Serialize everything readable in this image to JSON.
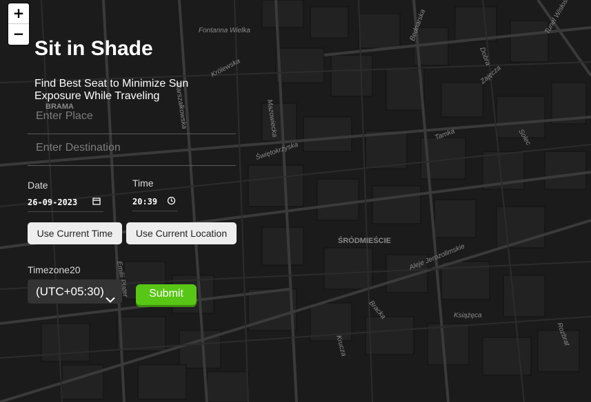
{
  "map": {
    "zoom_in_label": "+",
    "zoom_out_label": "−",
    "streets": [
      {
        "name": "Fontanna Wielka"
      },
      {
        "name": "Królewska"
      },
      {
        "name": "Marszałkowska"
      },
      {
        "name": "Mazowiecka"
      },
      {
        "name": "Świętokrzyska"
      },
      {
        "name": "Tamka"
      },
      {
        "name": "Dobra"
      },
      {
        "name": "Zajęcza"
      },
      {
        "name": "Solec"
      },
      {
        "name": "Aleje Jerozolimskie"
      },
      {
        "name": "Bracka"
      },
      {
        "name": "Krucza"
      },
      {
        "name": "Książęca"
      },
      {
        "name": "Tunel Wisłostrada"
      },
      {
        "name": "Bednarska"
      },
      {
        "name": "Emilii Plater"
      },
      {
        "name": "Rozbrat"
      }
    ],
    "districts": [
      {
        "name": "BRAMA"
      },
      {
        "name": "ŚRÓDMIEŚCIE"
      }
    ]
  },
  "header": {
    "title": "Sit in Shade",
    "subtitle": "Find Best Seat to Minimize Sun Exposure While Traveling"
  },
  "form": {
    "place_placeholder": "Enter Place",
    "destination_placeholder": "Enter Destination",
    "date_label": "Date",
    "date_value": "26-09-2023",
    "time_label": "Time",
    "time_value": "20:39",
    "use_current_time_label": "Use Current Time",
    "use_current_location_label": "Use Current Location",
    "timezone_label": "Timezone20",
    "timezone_value": "(UTC+05:30)",
    "submit_label": "Submit"
  },
  "colors": {
    "map_background": "#1b1b1b",
    "accent_submit": "#58c614",
    "button_light": "#eeeeee",
    "select_background": "#333333"
  }
}
